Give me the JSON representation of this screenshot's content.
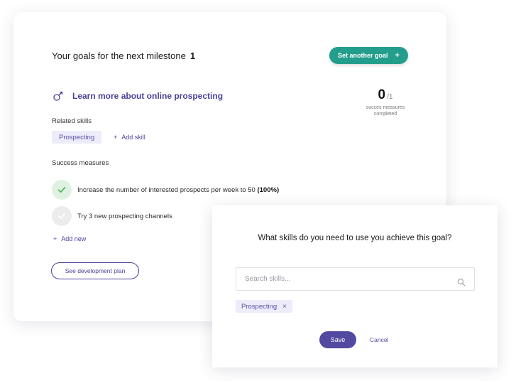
{
  "header": {
    "title": "Your goals for the next milestone",
    "count": "1",
    "set_goal_label": "Set another goal",
    "set_goal_plus": "+"
  },
  "goal": {
    "title": "Learn more about online prospecting",
    "progress_completed": "0",
    "progress_total": "/1",
    "progress_caption_line1": "succes measures",
    "progress_caption_line2": "completed"
  },
  "skills": {
    "label": "Related skills",
    "items": [
      "Prospecting"
    ],
    "add_label": "Add skill",
    "add_plus": "+"
  },
  "measures": {
    "label": "Success measures",
    "items": [
      {
        "text": "Increase the number of interested prospects per week to 50",
        "percent": "(100%)",
        "done": true
      },
      {
        "text": "Try 3 new prospecting channels",
        "percent": "",
        "done": false
      }
    ],
    "add_label": "Add new",
    "add_plus": "+"
  },
  "dev_plan_label": "See development plan",
  "dialog": {
    "question": "What skills do you need to use you achieve this goal?",
    "search_placeholder": "Search skills...",
    "selected_skill": "Prospecting",
    "remove_glyph": "×",
    "save_label": "Save",
    "cancel_label": "Cancel"
  },
  "colors": {
    "accent_teal": "#239e8c",
    "accent_purple": "#524aa0",
    "chip_bg": "#ececfa",
    "check_done_bg": "#dff2e2"
  },
  "icons": {
    "goal": "gender-male-icon",
    "check": "check-icon",
    "search": "search-icon"
  }
}
